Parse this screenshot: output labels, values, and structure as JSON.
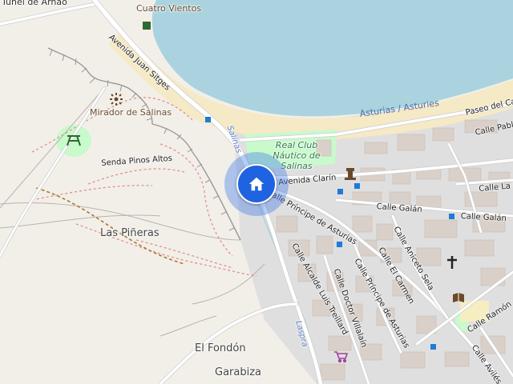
{
  "map": {
    "labels": {
      "tunnel": "Túnel de Arnao",
      "cuatro_vientos": "Cuatro Vientos",
      "av_juan_sitges": "Avenida Juan Sitges",
      "mirador": "Mirador de Salinas",
      "senda": "Senda Pinos Altos",
      "las_pineras": "Las Piñeras",
      "el_fondon": "El Fondón",
      "garabiza": "Garabiza",
      "real_club": "Real Club Náutico de Salinas",
      "avenida_clarin": "Avenida Clarín",
      "principe_asturias_1": "Calle Príncipe de Asturias",
      "principe_asturias_2": "Calle Príncipe de Asturias",
      "alcalde_luis_treillard": "Calle Alcalde Luis Treillard",
      "doctor_villalain": "Calle Doctor Villalaín",
      "el_carmen": "Calle El Carmen",
      "aniceto_sela": "Calle Aniceto Sela",
      "galan_1": "Calle Galán",
      "galan_2": "Calle Galán",
      "pablo": "Calle Pablo",
      "la_u": "Calle La U",
      "ramon": "Calle Ramón",
      "aviles": "Calle Avilés",
      "paseo": "Paseo del Ca",
      "asturias_coast": "Asturias / Asturies",
      "salinas_street": "Salinas",
      "laspra": "Laspra"
    },
    "marker": {
      "type": "home",
      "icon": "home-icon"
    },
    "colors": {
      "sea": "#aad3df",
      "beach": "#f5e9c6",
      "land": "#f2efe9",
      "residential": "#e0dfdf",
      "building": "#d9d0c9",
      "park": "#c8facc",
      "marker": "#1f63e0"
    }
  }
}
